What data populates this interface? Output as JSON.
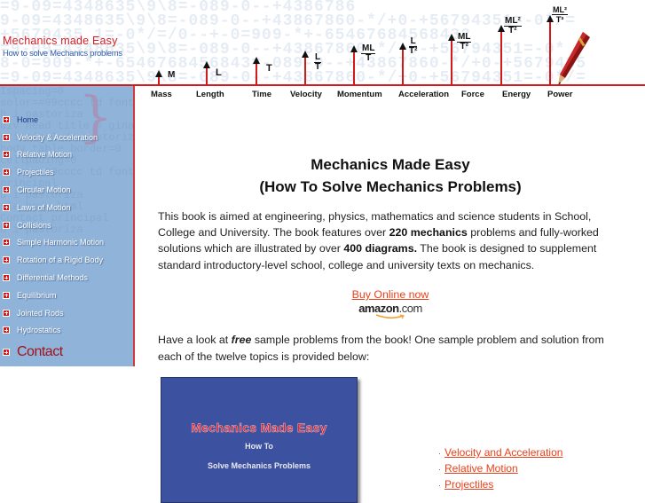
{
  "header": {
    "site_title": "Mechanics made Easy",
    "site_subtitle": "How to solve Mechanics problems",
    "bg_numbers": "=9-09=4348635\\9\\8=-089-0--+4386786\n9-09=4348635\\9\\8=-089-0--+43867860-*/+0-+56794351=-0*/=\n+5679435 1=-0*/=/0--+-0=909-*+-65467684568432\n=9-09=4348635\\9\\8=-089-0--+43867860-*/+0-+56794351=-0*\n8-0=909-*+-6546768456843=-089-0--+43867860-*/+0-+5679435\n=9-09=4348635\\9\\8=-089-0--+43867860-*/+0-+56794351=-0*/=",
    "units": [
      {
        "name": "Mass",
        "dimension_top": "M",
        "dimension_bottom": ""
      },
      {
        "name": "Length",
        "dimension_top": "L",
        "dimension_bottom": ""
      },
      {
        "name": "Time",
        "dimension_top": "T",
        "dimension_bottom": ""
      },
      {
        "name": "Velocity",
        "dimension_top": "L",
        "dimension_bottom": "T"
      },
      {
        "name": "Momentum",
        "dimension_top": "ML",
        "dimension_bottom": "T"
      },
      {
        "name": "Acceleration",
        "dimension_top": "L",
        "dimension_bottom": "T²"
      },
      {
        "name": "Force",
        "dimension_top": "ML",
        "dimension_bottom": "T²"
      },
      {
        "name": "Energy",
        "dimension_top": "ML²",
        "dimension_bottom": "T²"
      },
      {
        "name": "Power",
        "dimension_top": "ML²",
        "dimension_bottom": "T³"
      }
    ]
  },
  "sidebar": {
    "bg_code": "Ispacing=0\nsolor=#99cccc td font\nb i pastoriza\ndiv head title # gina\nprincipal de pastoriza /title\nbody table border=0\ncellpading=0\nsolor=#99cccc td font\nprincipal\nb i pastoriza\nsle body html\nContact principal\nb i pastoriza",
    "items": [
      {
        "label": "Home"
      },
      {
        "label": "Velocity & Acceleration"
      },
      {
        "label": "Relative Motion"
      },
      {
        "label": "Projectiles"
      },
      {
        "label": "Circular Motion"
      },
      {
        "label": "Laws of Motion"
      },
      {
        "label": "Collisions"
      },
      {
        "label": "Simple Harmonic Motion"
      },
      {
        "label": "Rotation of a Rigid Body"
      },
      {
        "label": "Differential Methods"
      },
      {
        "label": "Equilibrium"
      },
      {
        "label": "Jointed Rods"
      },
      {
        "label": "Hydrostatics"
      }
    ],
    "contact_label": "Contact"
  },
  "main": {
    "title_line1": "Mechanics Made Easy",
    "title_line2": "(How To Solve Mechanics Problems)",
    "intro": {
      "part1": "This book is aimed at engineering, physics, mathematics and science students in School, College and University. The book features over ",
      "bold1": "220 mechanics",
      "part2": " problems and fully-worked solutions which are illustrated by over ",
      "bold2": "400 diagrams.",
      "part3": " The book is designed to supplement standard introductory-level school, college and university texts on mechanics."
    },
    "buy_link": "Buy Online now",
    "amazon_logo": {
      "main": "amazon",
      "suffix": ".com"
    },
    "free_text": {
      "part1": "Have a look at ",
      "emphasis": "free",
      "part2": " sample problems from the book! One sample problem and solution from each of the twelve topics is provided below:"
    },
    "book_cover": {
      "title": "Mechanics Made Easy",
      "subtitle_line1": "How To",
      "subtitle_line2": "Solve Mechanics Problems"
    },
    "topic_links": [
      {
        "label": "Velocity and Acceleration"
      },
      {
        "label": "Relative Motion"
      },
      {
        "label": "Projectiles"
      }
    ]
  },
  "colors": {
    "accent_red": "#d21a1a",
    "sidebar_blue": "#8fb3d9",
    "link_orange": "#e8421c",
    "cover_blue": "#3c519f",
    "contact_red": "#a3131c"
  }
}
